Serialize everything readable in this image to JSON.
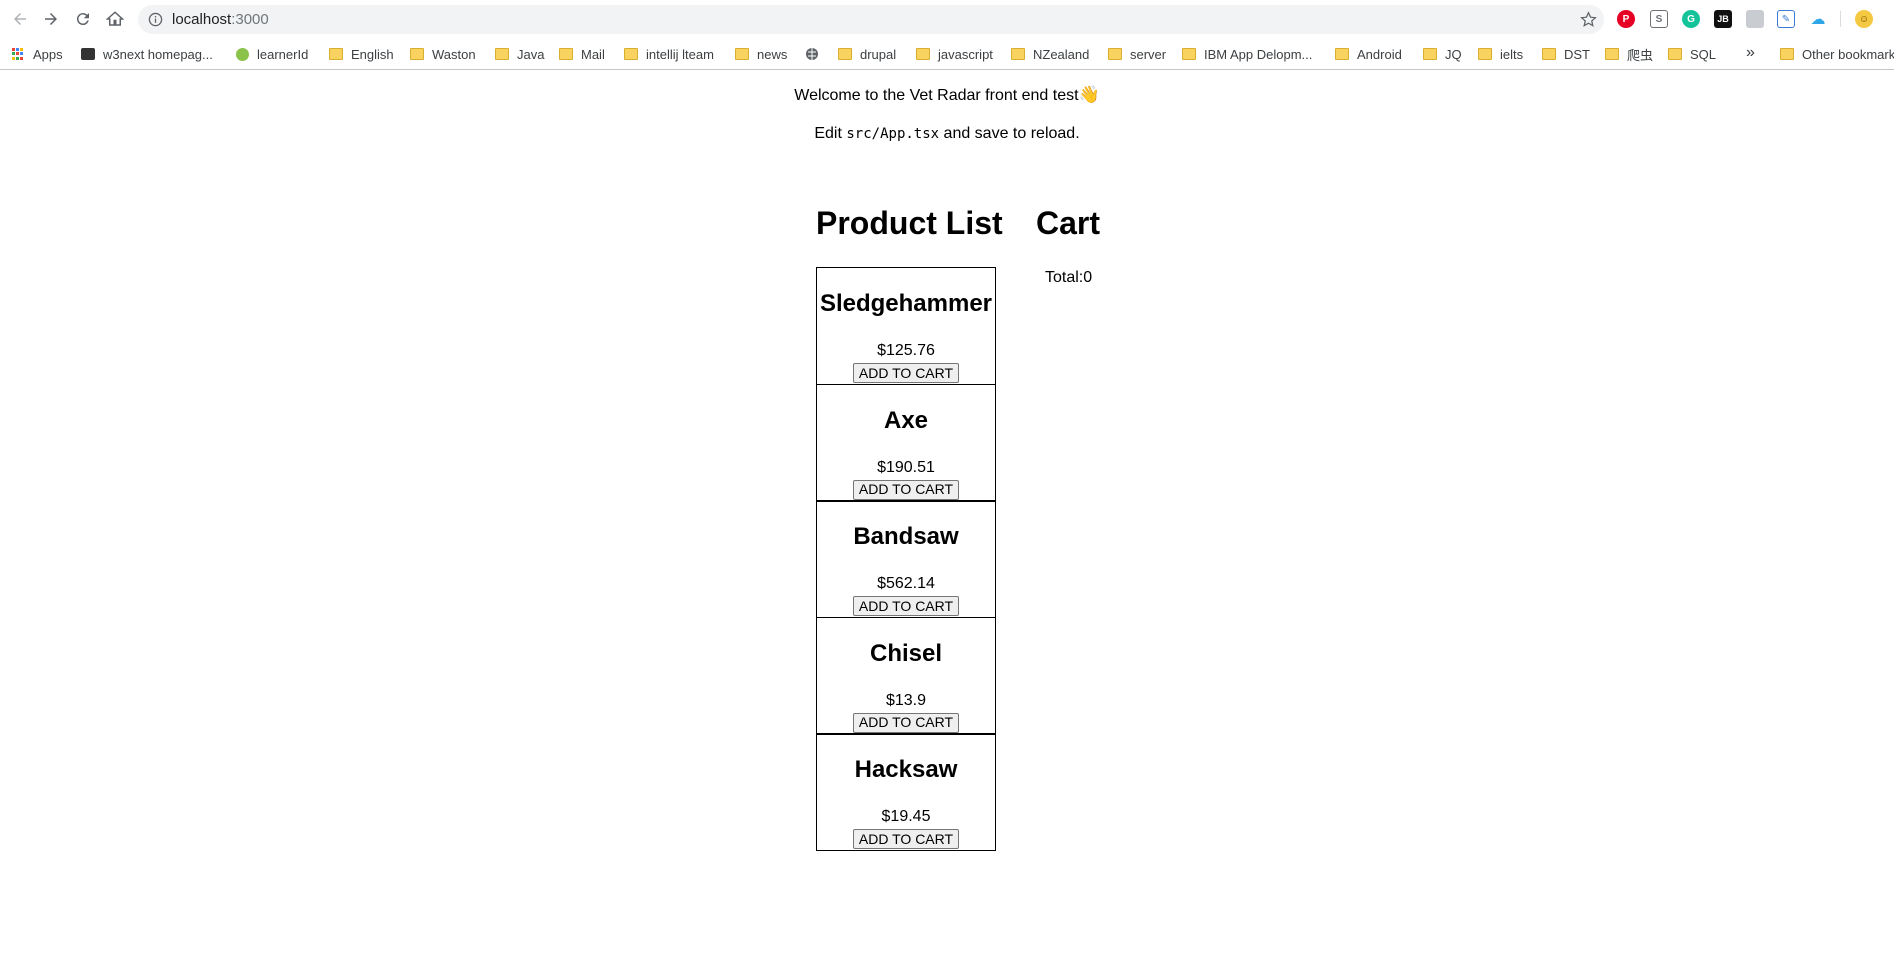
{
  "browser": {
    "url_host": "localhost",
    "url_port": ":3000",
    "bookmarks": [
      {
        "label": "Apps",
        "icon": "apps-grid-icon"
      },
      {
        "label": "w3next homepag...",
        "icon": "w3-icon"
      },
      {
        "label": "learnerId",
        "icon": "learner-icon"
      },
      {
        "label": "English",
        "icon": "folder-icon"
      },
      {
        "label": "Waston",
        "icon": "folder-icon"
      },
      {
        "label": "Java",
        "icon": "folder-icon"
      },
      {
        "label": "Mail",
        "icon": "folder-icon"
      },
      {
        "label": "intellij lteam",
        "icon": "folder-icon"
      },
      {
        "label": "news",
        "icon": "folder-icon"
      },
      {
        "label": "",
        "icon": "globe-icon"
      },
      {
        "label": "drupal",
        "icon": "folder-icon"
      },
      {
        "label": "javascript",
        "icon": "folder-icon"
      },
      {
        "label": "NZealand",
        "icon": "folder-icon"
      },
      {
        "label": "server",
        "icon": "folder-icon"
      },
      {
        "label": "IBM App Delopm...",
        "icon": "folder-icon"
      },
      {
        "label": "Android",
        "icon": "folder-icon"
      },
      {
        "label": "JQ",
        "icon": "folder-icon"
      },
      {
        "label": "ielts",
        "icon": "folder-icon"
      },
      {
        "label": "DST",
        "icon": "folder-icon"
      },
      {
        "label": "爬虫",
        "icon": "folder-icon"
      },
      {
        "label": "SQL",
        "icon": "folder-icon"
      },
      {
        "label": "Other bookmarks",
        "icon": "folder-icon"
      }
    ],
    "more_label": "»"
  },
  "app": {
    "welcome_text": "Welcome to the Vet Radar front end test",
    "wave_emoji": "👋",
    "edit_prefix": "Edit ",
    "edit_code": "src/App.tsx",
    "edit_suffix": " and save to reload.",
    "product_list_title": "Product List",
    "cart_title": "Cart",
    "cart_total": "Total:0",
    "add_to_cart_label": "ADD TO CART",
    "products": [
      {
        "name": "Sledgehammer",
        "price": "$125.76"
      },
      {
        "name": "Axe",
        "price": "$190.51"
      },
      {
        "name": "Bandsaw",
        "price": "$562.14"
      },
      {
        "name": "Chisel",
        "price": "$13.9"
      },
      {
        "name": "Hacksaw",
        "price": "$19.45"
      }
    ]
  }
}
